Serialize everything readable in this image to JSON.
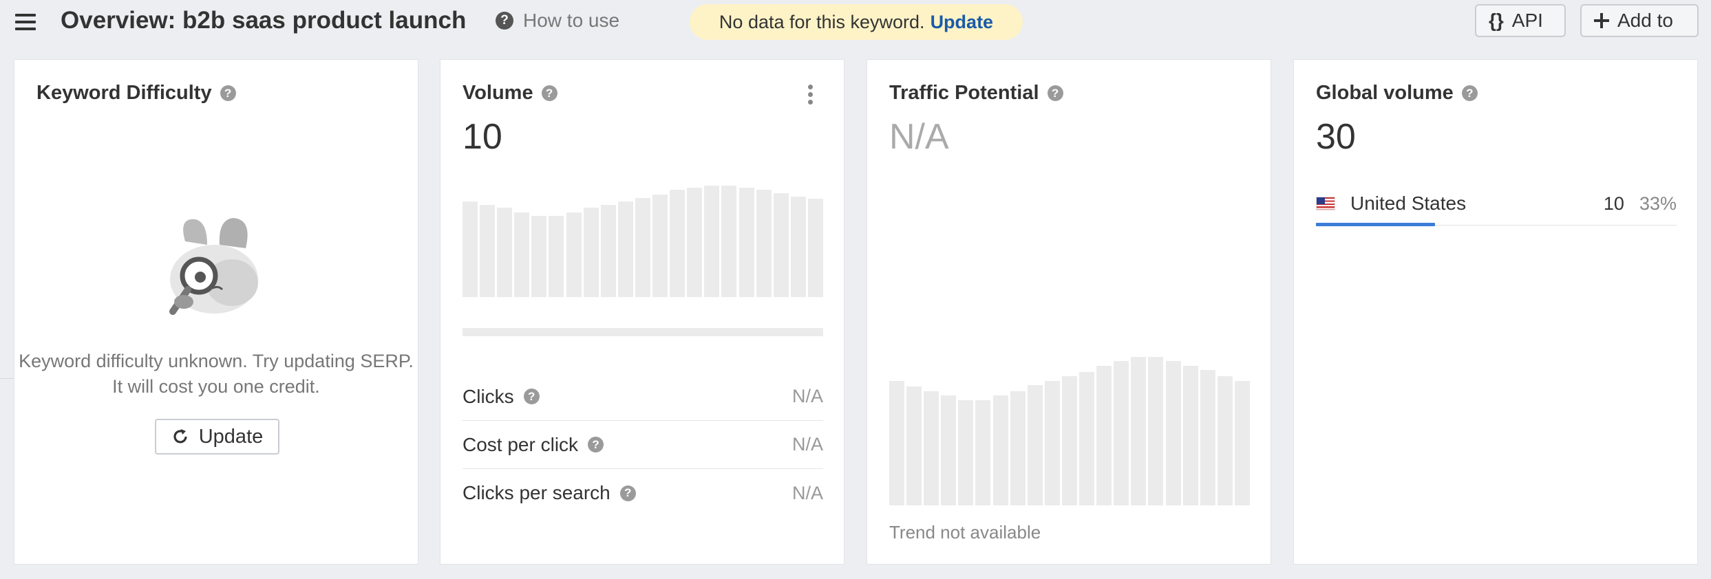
{
  "header": {
    "title": "Overview: b2b saas product launch",
    "how_to": "How to use",
    "banner": {
      "text": "No data for this keyword.",
      "link": "Update"
    },
    "api_label": "API",
    "api_icon": "{}",
    "add_to_label": "Add to"
  },
  "keyword_difficulty": {
    "title": "Keyword Difficulty",
    "message": "Keyword difficulty unknown. Try updating SERP. It will cost you one credit.",
    "update_label": "Update"
  },
  "volume": {
    "title": "Volume",
    "value": "10",
    "trend_levels": [
      0.86,
      0.83,
      0.8,
      0.76,
      0.73,
      0.73,
      0.76,
      0.8,
      0.83,
      0.86,
      0.89,
      0.92,
      0.96,
      0.98,
      1.0,
      1.0,
      0.98,
      0.96,
      0.93,
      0.9,
      0.88
    ],
    "metrics": [
      {
        "label": "Clicks",
        "value": "N/A"
      },
      {
        "label": "Cost per click",
        "value": "N/A"
      },
      {
        "label": "Clicks per search",
        "value": "N/A"
      }
    ]
  },
  "traffic_potential": {
    "title": "Traffic Potential",
    "value": "N/A",
    "trend_levels": [
      0.84,
      0.8,
      0.77,
      0.74,
      0.71,
      0.71,
      0.74,
      0.77,
      0.81,
      0.84,
      0.87,
      0.9,
      0.94,
      0.97,
      1.0,
      1.0,
      0.97,
      0.94,
      0.91,
      0.87,
      0.84
    ],
    "trend_note": "Trend not available"
  },
  "global_volume": {
    "title": "Global volume",
    "value": "30",
    "countries": [
      {
        "name": "United States",
        "volume": "10",
        "percent": "33%",
        "share": 0.33,
        "flag": "us-flag-icon"
      }
    ]
  },
  "colors": {
    "accent": "#3b7dd8",
    "link": "#1a5ba8",
    "banner_bg": "#fdf3c7",
    "bar": "#ebebeb"
  }
}
